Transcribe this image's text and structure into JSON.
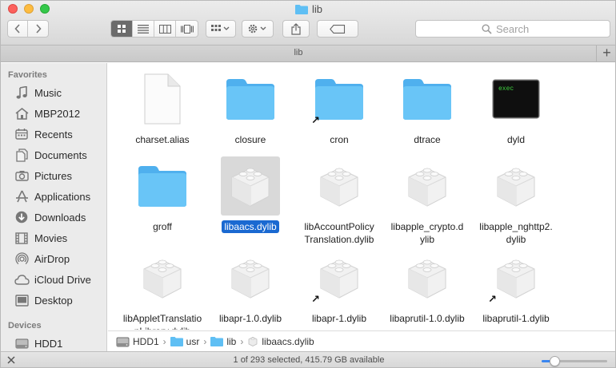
{
  "window": {
    "title": "lib",
    "tab_title": "lib",
    "add_tab_label": "+"
  },
  "toolbar": {
    "back_icon": "chevron-left-icon",
    "forward_icon": "chevron-right-icon",
    "view_modes": [
      "icon-view",
      "list-view",
      "column-view",
      "cover-flow-view"
    ],
    "active_view": "icon-view",
    "search_placeholder": "Search"
  },
  "sidebar": {
    "favorites_header": "Favorites",
    "favorites": [
      {
        "label": "Music",
        "icon": "music-icon"
      },
      {
        "label": "MBP2012",
        "icon": "home-icon"
      },
      {
        "label": "Recents",
        "icon": "recents-icon"
      },
      {
        "label": "Documents",
        "icon": "documents-icon"
      },
      {
        "label": "Pictures",
        "icon": "pictures-icon"
      },
      {
        "label": "Applications",
        "icon": "applications-icon"
      },
      {
        "label": "Downloads",
        "icon": "downloads-icon"
      },
      {
        "label": "Movies",
        "icon": "movies-icon"
      },
      {
        "label": "AirDrop",
        "icon": "airdrop-icon"
      },
      {
        "label": "iCloud Drive",
        "icon": "icloud-icon"
      },
      {
        "label": "Desktop",
        "icon": "desktop-icon"
      }
    ],
    "devices_header": "Devices",
    "devices": [
      {
        "label": "HDD1",
        "icon": "hard-drive-icon"
      }
    ]
  },
  "files": [
    {
      "name": "charset.alias",
      "kind": "document",
      "alias": false,
      "selected": false
    },
    {
      "name": "closure",
      "kind": "folder",
      "alias": false,
      "selected": false
    },
    {
      "name": "cron",
      "kind": "folder",
      "alias": true,
      "selected": false
    },
    {
      "name": "dtrace",
      "kind": "folder",
      "alias": false,
      "selected": false
    },
    {
      "name": "dyld",
      "kind": "exec",
      "alias": false,
      "selected": false
    },
    {
      "name": "groff",
      "kind": "folder",
      "alias": false,
      "selected": false
    },
    {
      "name": "libaacs.dylib",
      "kind": "dylib",
      "alias": false,
      "selected": true
    },
    {
      "name": "libAccountPolicyTranslation.dylib",
      "kind": "dylib",
      "alias": false,
      "selected": false
    },
    {
      "name": "libapple_crypto.dylib",
      "kind": "dylib",
      "alias": false,
      "selected": false
    },
    {
      "name": "libapple_nghttp2.dylib",
      "kind": "dylib",
      "alias": false,
      "selected": false
    },
    {
      "name": "libAppletTranslationLibrary.dylib",
      "kind": "dylib",
      "alias": false,
      "selected": false
    },
    {
      "name": "libapr-1.0.dylib",
      "kind": "dylib",
      "alias": false,
      "selected": false
    },
    {
      "name": "libapr-1.dylib",
      "kind": "dylib",
      "alias": true,
      "selected": false
    },
    {
      "name": "libaprutil-1.0.dylib",
      "kind": "dylib",
      "alias": false,
      "selected": false
    },
    {
      "name": "libaprutil-1.dylib",
      "kind": "dylib",
      "alias": true,
      "selected": false
    }
  ],
  "exec_badge": "exec",
  "pathbar": {
    "segments": [
      {
        "label": "HDD1",
        "icon": "hard-drive-icon"
      },
      {
        "label": "usr",
        "icon": "folder-icon"
      },
      {
        "label": "lib",
        "icon": "folder-icon"
      },
      {
        "label": "libaacs.dylib",
        "icon": "dylib-icon"
      }
    ],
    "separator": "›"
  },
  "status": {
    "text": "1 of 293 selected, 415.79 GB available",
    "icon_size_fraction": 0.2
  },
  "colors": {
    "folder": "#5fbff4",
    "selection": "#1a69d1",
    "accent": "#3a86f0"
  }
}
